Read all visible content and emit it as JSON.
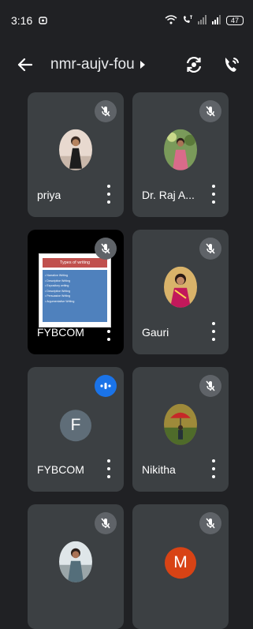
{
  "status_bar": {
    "time": "3:16",
    "battery": "47"
  },
  "top_bar": {
    "meeting_code": "nmr-aujv-fou",
    "icons": [
      "back-arrow-icon",
      "chevron-right-icon",
      "switch-camera-icon",
      "phone-audio-icon"
    ]
  },
  "participants": [
    {
      "name": "priya",
      "mic": "muted",
      "avatar": "photo"
    },
    {
      "name": "Dr. Raj A...",
      "mic": "muted",
      "avatar": "photo"
    },
    {
      "name": "FYBCOM",
      "mic": "muted",
      "avatar": "screen-share"
    },
    {
      "name": "Gauri",
      "mic": "muted",
      "avatar": "photo"
    },
    {
      "name": "FYBCOM",
      "mic": "speaking",
      "avatar": "letter",
      "letter": "F",
      "color": "#5f6d78"
    },
    {
      "name": "Nikitha",
      "mic": "muted",
      "avatar": "photo"
    },
    {
      "name": "",
      "mic": "muted",
      "avatar": "photo"
    },
    {
      "name": "",
      "mic": "muted",
      "avatar": "letter",
      "letter": "M",
      "color": "#d84315"
    }
  ],
  "shared_slide": {
    "title": "Types of writing",
    "bullets": [
      "Narrative Writing",
      "Descriptive Writing",
      "Expository writing",
      "Descriptive Writing",
      "Persuasive Writing",
      "Argumentative Writing"
    ]
  },
  "colors": {
    "background": "#202124",
    "tile": "#3c4043",
    "mic_muted": "#5f6368",
    "mic_speaking": "#1a73e8"
  }
}
